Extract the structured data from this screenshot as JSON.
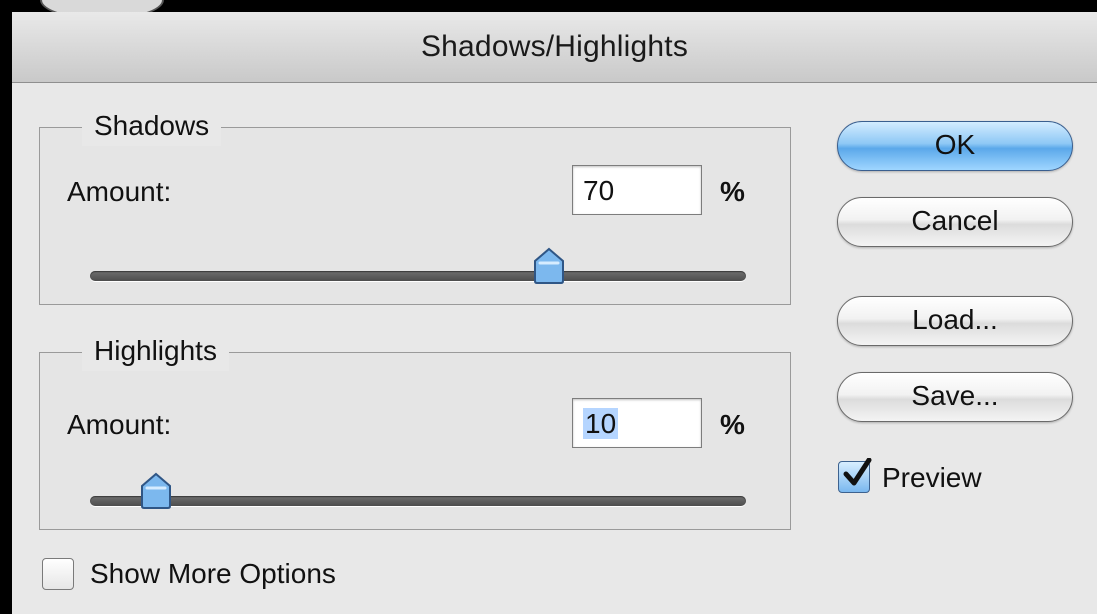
{
  "window": {
    "title": "Shadows/Highlights"
  },
  "shadows": {
    "legend": "Shadows",
    "amount_label": "Amount:",
    "amount_value": "70",
    "unit": "%",
    "slider_value": 70
  },
  "highlights": {
    "legend": "Highlights",
    "amount_label": "Amount:",
    "amount_value": "10",
    "unit": "%",
    "slider_value": 10
  },
  "buttons": {
    "ok": "OK",
    "cancel": "Cancel",
    "load": "Load...",
    "save": "Save..."
  },
  "preview": {
    "label": "Preview",
    "checked": true
  },
  "more_options": {
    "label": "Show More Options",
    "checked": false
  },
  "colors": {
    "accent": "#5ba8ea",
    "selection": "#b5d5ff"
  }
}
